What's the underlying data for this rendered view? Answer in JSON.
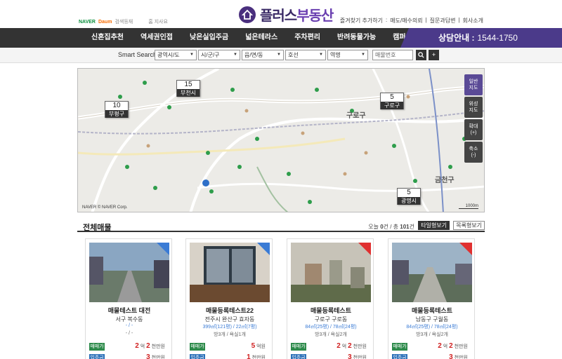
{
  "header": {
    "naver_logo": "NAVER",
    "daum_logo": "Daum",
    "partner_text": "검색등재",
    "home_link": "홈 지사요",
    "logo_text_1": "플러스",
    "logo_text_2": "부동산",
    "toplinks": [
      "즐겨찾기 추가하기",
      "매도/매수의뢰",
      "질문과답변",
      "회사소개"
    ]
  },
  "nav": {
    "items": [
      "신혼집추천",
      "역세권인접",
      "낮은실입주금",
      "넓은테라스",
      "주차편리",
      "반려동물가능",
      "캠퍼스인접"
    ],
    "cta_label": "상담안내 :",
    "cta_phone": "1544-1750"
  },
  "search": {
    "label": "Smart Search",
    "selects": [
      "광역시/도",
      "시/군/구",
      "읍/면/동",
      "호선",
      "역명"
    ],
    "input_placeholder": "매물번호"
  },
  "map": {
    "clusters": [
      {
        "count": "15",
        "label": "부천시"
      },
      {
        "count": "10",
        "label": "부평구"
      },
      {
        "count": "5",
        "label": "구로구"
      },
      {
        "count": "5",
        "label": "광명시"
      }
    ],
    "district_labels": [
      "구로구",
      "금천구"
    ],
    "controls": [
      {
        "label": "일반\n지도"
      },
      {
        "label": "위성\n지도"
      },
      {
        "label": "확대\n(+)"
      },
      {
        "label": "축소\n(-)"
      }
    ],
    "footer": "NAVER © NAVER Corp.",
    "scale": "1000m"
  },
  "listing": {
    "title": "전체매물",
    "count_prefix": "오늘",
    "count_today": "0",
    "count_mid": "건 / 총",
    "count_total": "101",
    "count_suffix": "건",
    "view_tile": "타일형보기",
    "view_list": "목록형보기",
    "cards": [
      {
        "title": "매물테스트 대전",
        "address": "서구 복수동",
        "size": "- / -",
        "rooms": "- / -",
        "ribbon": "blue",
        "row1": {
          "badge": "매매가",
          "big1": "2",
          "u1": "억",
          "big2": "2",
          "u2": "천만원"
        },
        "row2": {
          "badge": "입주금",
          "big1": "3",
          "u1": "",
          "big2": "",
          "u2": "천만원"
        }
      },
      {
        "title": "매물등록테스트22",
        "address": "전주시 완산구 효자동",
        "size": "399㎡(121평) / 22㎡(7평)",
        "rooms": "방3개 / 욕실1개",
        "ribbon": "blue",
        "row1": {
          "badge": "매매가",
          "big1": "5",
          "u1": "억원",
          "big2": "",
          "u2": ""
        },
        "row2": {
          "badge": "입주금",
          "big1": "1",
          "u1": "",
          "big2": "",
          "u2": "천만원"
        }
      },
      {
        "title": "매물등록테스트",
        "address": "구로구 구로동",
        "size": "84㎡(25평) / 78㎡(24평)",
        "rooms": "방3개 / 욕실2개",
        "ribbon": "red",
        "row1": {
          "badge": "매매가",
          "big1": "2",
          "u1": "억",
          "big2": "2",
          "u2": "천만원"
        },
        "row2": {
          "badge": "입주금",
          "big1": "3",
          "u1": "",
          "big2": "",
          "u2": "천만원"
        }
      },
      {
        "title": "매물등록테스트",
        "address": "남동구 구월동",
        "size": "84㎡(25평) / 78㎡(24평)",
        "rooms": "방3개 / 욕실2개",
        "ribbon": "red",
        "row1": {
          "badge": "매매가",
          "big1": "2",
          "u1": "억",
          "big2": "2",
          "u2": "천만원"
        },
        "row2": {
          "badge": "입주금",
          "big1": "3",
          "u1": "",
          "big2": "",
          "u2": "천만원"
        }
      }
    ]
  },
  "colors": {
    "brand_purple": "#4b3a8a",
    "nav_dark": "#333333",
    "price_red": "#d02020",
    "sale_green": "#2c8a4a",
    "deposit_blue": "#2a6fb8"
  }
}
